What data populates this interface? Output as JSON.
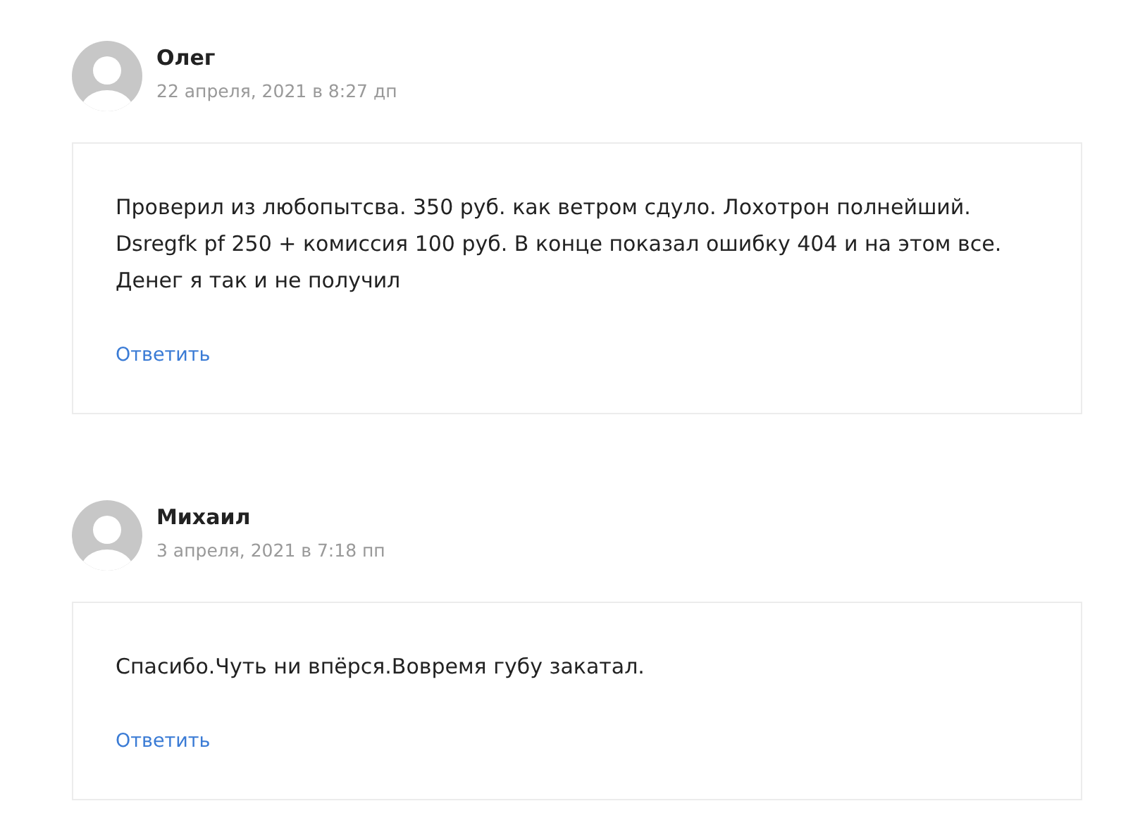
{
  "comments": [
    {
      "author": "Олег",
      "date": "22 апреля, 2021 в 8:27 дп",
      "text": "Проверил из любопытсва. 350 руб. как ветром сдуло. Лохотрон полнейший. Dsregfk pf 250 + комиссия 100 руб. В конце показал ошибку 404 и на этом все. Денег я так и не получил",
      "reply": "Ответить"
    },
    {
      "author": "Михаил",
      "date": "3 апреля, 2021 в 7:18 пп",
      "text": "Спасибо.Чуть ни впёрся.Вовремя губу закатал.",
      "reply": "Ответить"
    }
  ]
}
